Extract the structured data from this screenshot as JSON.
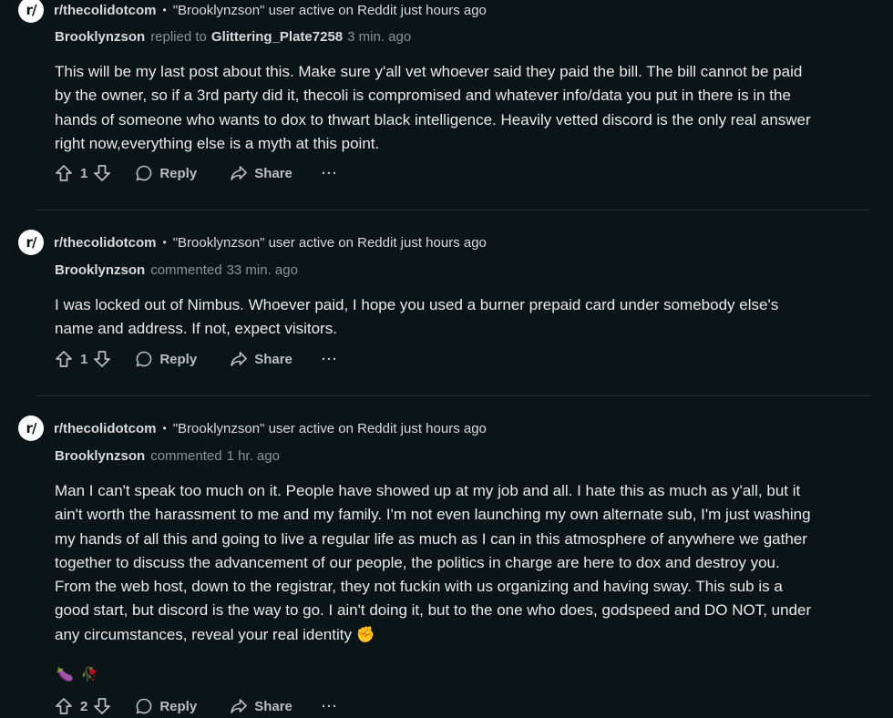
{
  "comments": [
    {
      "subreddit": "r/thecolidotcom",
      "headline": "\"Brooklynzson\" user active on Reddit just hours ago",
      "author": "Brooklynzson",
      "action": "replied to",
      "target": "Glittering_Plate7258",
      "time": "3 min. ago",
      "body": "This will be my last post about this. Make sure y'all vet whoever said they paid the bill. The bill cannot be paid by the owner, so if a 3rd party did it, thecoli is compromised and whatever info/data you put in there is in the hands of someone who wants to dox to thwart black intelligence. Heavily vetted discord is the only real answer right now,everything else is a myth at this point.",
      "votes": "1",
      "reply_label": "Reply",
      "share_label": "Share",
      "more_label": "···"
    },
    {
      "subreddit": "r/thecolidotcom",
      "headline": "\"Brooklynzson\" user active on Reddit just hours ago",
      "author": "Brooklynzson",
      "action": "commented",
      "target": "",
      "time": "33 min. ago",
      "body": "I was locked out of Nimbus. Whoever paid, I hope you used a burner prepaid card under somebody else's name and address. If not, expect visitors.",
      "votes": "1",
      "reply_label": "Reply",
      "share_label": "Share",
      "more_label": "···"
    },
    {
      "subreddit": "r/thecolidotcom",
      "headline": "\"Brooklynzson\" user active on Reddit just hours ago",
      "author": "Brooklynzson",
      "action": "commented",
      "target": "",
      "time": "1 hr. ago",
      "body": "Man I can't speak too much on it. People have showed up at my job and all. I hate this as much as y'all, but it ain't worth the harassment to me and my family. I'm not even launching my own alternate sub, I'm just washing my hands of all this and going to live a regular life as much as I can in this atmosphere of anywhere we gather together to discuss the advancement of our people, the politics in charge are here to dox and destroy you. From the web host, down to the registrar, they not fuckin with us organizing and having sway. This sub is a good start, but discord is the way to go. I ain't doing it, but to the one who does, godspeed and DO NOT, under any circumstances, reveal your real identity ✊",
      "reactions": [
        "🍆",
        "🥀"
      ],
      "votes": "2",
      "reply_label": "Reply",
      "share_label": "Share",
      "more_label": "···"
    }
  ],
  "avatar_glyph": "r/",
  "separator": "•",
  "colors": {
    "background": "#0b1416",
    "text": "#d7dadc",
    "muted": "#8a9499",
    "divider": "#2a3236"
  }
}
